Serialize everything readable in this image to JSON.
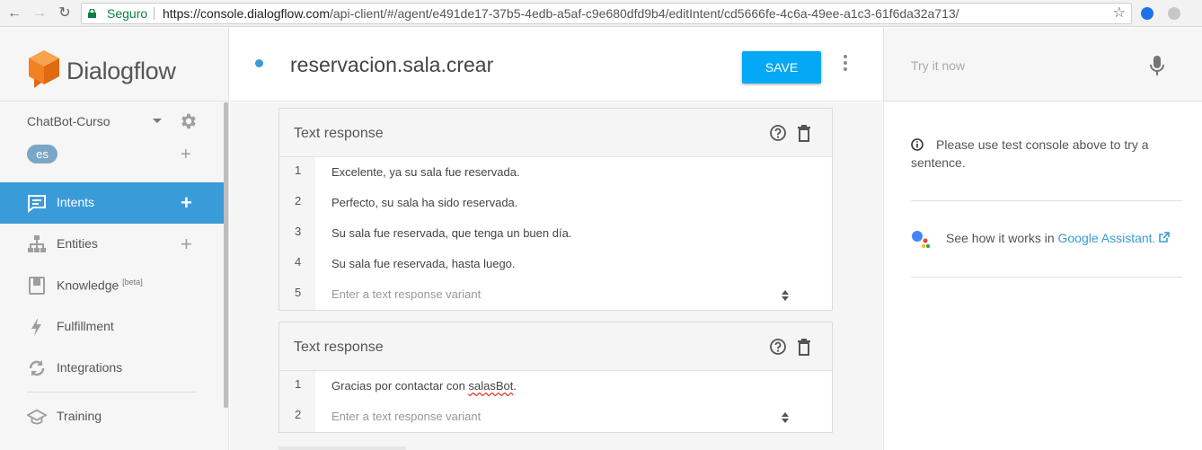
{
  "browser": {
    "secure_label": "Seguro",
    "url_host": "https://console.dialogflow.com",
    "url_path": "/api-client/#/agent/e491de17-37b5-4edb-a5af-c9e680dfd9b4/editIntent/cd5666fe-4c6a-49ee-a1c3-61f6da32a713/"
  },
  "brand": {
    "name": "Dialogflow"
  },
  "agent": {
    "name": "ChatBot-Curso",
    "language": "es"
  },
  "sidebar": {
    "items": [
      {
        "label": "Intents",
        "icon": "chat-icon",
        "active": true
      },
      {
        "label": "Entities",
        "icon": "hierarchy-icon"
      },
      {
        "label": "Knowledge",
        "beta": "[beta]",
        "icon": "book-icon"
      },
      {
        "label": "Fulfillment",
        "icon": "bolt-icon"
      },
      {
        "label": "Integrations",
        "icon": "sync-icon"
      },
      {
        "label": "Training",
        "icon": "graduation-cap-icon"
      }
    ]
  },
  "header": {
    "intent_name": "reservacion.sala.crear",
    "save_label": "SAVE"
  },
  "responses": [
    {
      "title": "Text response",
      "rows": [
        {
          "num": "1",
          "text": "Excelente, ya su sala fue reservada."
        },
        {
          "num": "2",
          "text": "Perfecto, su sala ha sido reservada."
        },
        {
          "num": "3",
          "text": "Su sala fue reservada, que tenga un buen día."
        },
        {
          "num": "4",
          "text": "Su sala fue reservada, hasta luego."
        },
        {
          "num": "5",
          "placeholder": "Enter a text response variant"
        }
      ]
    },
    {
      "title": "Text response",
      "rows": [
        {
          "num": "1",
          "text_before": "Gracias por contactar con ",
          "text_misspelled": "salasBot",
          "text_after": "."
        },
        {
          "num": "2",
          "placeholder": "Enter a text response variant"
        }
      ]
    }
  ],
  "console": {
    "placeholder": "Try it now",
    "info": "Please use test console above to try a sentence.",
    "assistant_prefix": "See how it works in ",
    "assistant_link": "Google Assistant."
  },
  "colors": {
    "accent": "#3a9bd9",
    "save_button": "#03a9f4",
    "logo_orange": "#f48024"
  }
}
